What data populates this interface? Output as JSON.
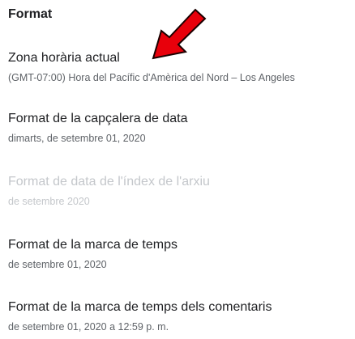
{
  "format": {
    "title": "Format",
    "settings": [
      {
        "label": "Zona horària actual",
        "value": "(GMT-07:00) Hora del Pacífic d'Amèrica del Nord – Los Angeles",
        "disabled": false
      },
      {
        "label": "Format de la capçalera de data",
        "value": "dimarts, de setembre 01, 2020",
        "disabled": false
      },
      {
        "label": "Format de data de l'índex de l'arxiu",
        "value": "de setembre 2020",
        "disabled": true
      },
      {
        "label": "Format de la marca de temps",
        "value": "de setembre 01, 2020",
        "disabled": false
      },
      {
        "label": "Format de la marca de temps dels comentaris",
        "value": "de setembre 01, 2020 a 12:59 p. m.",
        "disabled": false
      }
    ]
  },
  "annotation": {
    "arrow_color": "#e8000b",
    "arrow_outline": "#1a0000"
  }
}
